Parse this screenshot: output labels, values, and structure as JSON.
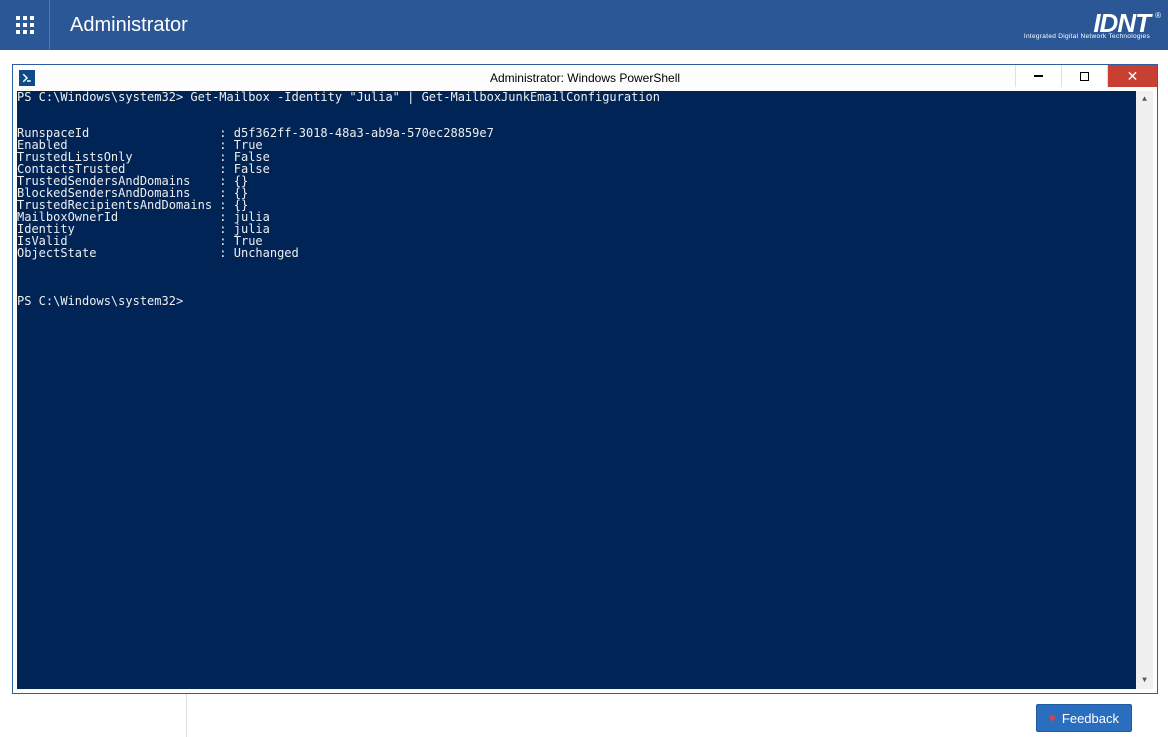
{
  "banner": {
    "title": "Administrator",
    "brand_main": "IDNT",
    "brand_reg": "®",
    "brand_sub": "Integrated Digital Network Technologies"
  },
  "powershell_window": {
    "title": "Administrator: Windows PowerShell",
    "command": "PS C:\\Windows\\system32> Get-Mailbox -Identity \"Julia\" | Get-MailboxJunkEmailConfiguration",
    "result_properties": [
      {
        "name": "RunspaceId",
        "value": "d5f362ff-3018-48a3-ab9a-570ec28859e7"
      },
      {
        "name": "Enabled",
        "value": "True"
      },
      {
        "name": "TrustedListsOnly",
        "value": "False"
      },
      {
        "name": "ContactsTrusted",
        "value": "False"
      },
      {
        "name": "TrustedSendersAndDomains",
        "value": "{}"
      },
      {
        "name": "BlockedSendersAndDomains",
        "value": "{}"
      },
      {
        "name": "TrustedRecipientsAndDomains",
        "value": "{}"
      },
      {
        "name": "MailboxOwnerId",
        "value": "julia"
      },
      {
        "name": "Identity",
        "value": "julia"
      },
      {
        "name": "IsValid",
        "value": "True"
      },
      {
        "name": "ObjectState",
        "value": "Unchanged"
      }
    ],
    "prompt_after": "PS C:\\Windows\\system32>"
  },
  "feedback": {
    "label": "Feedback"
  }
}
